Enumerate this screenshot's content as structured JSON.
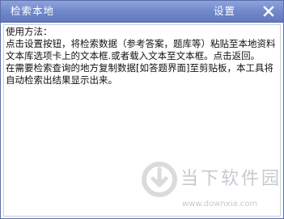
{
  "window": {
    "title": "检索本地",
    "settings_label": "设置",
    "close_icon": "close-icon"
  },
  "editor": {
    "content": "使用方法：\n点击设置按钮，将检索数据（参考答案，题库等）粘贴至本地资料文本库选项卡上的文本框.或者载入文本至文本框。点击返回。\n在需要检索查询的地方复制数据[如答题界面]至剪贴板，本工具将自动检索出结果显示出来。"
  },
  "watermark": {
    "brand": "当下软件园",
    "url": "www.downxia.com"
  },
  "colors": {
    "titlebar": "#6f86c8",
    "title_text": "#ffffff"
  }
}
